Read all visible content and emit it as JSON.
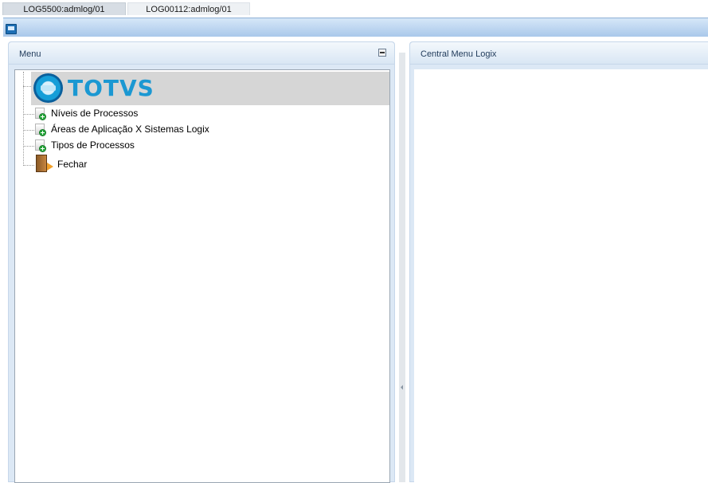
{
  "session_tabs": [
    {
      "label": "LOG5500:admlog/01"
    },
    {
      "label": "LOG00112:admlog/01"
    }
  ],
  "menu_panel": {
    "title": "Menu",
    "logo_text": "TOTVS",
    "items": [
      {
        "label": "Níveis de Processos",
        "icon": "document-add-icon"
      },
      {
        "label": "Áreas de Aplicação X Sistemas Logix",
        "icon": "document-add-icon"
      },
      {
        "label": "Tipos de Processos",
        "icon": "document-add-icon"
      },
      {
        "label": "Fechar",
        "icon": "exit-door-icon"
      }
    ]
  },
  "central_panel": {
    "title": "Central Menu Logix"
  },
  "colors": {
    "window_bar": "#a9c8ea",
    "panel_bg": "#dce8f5",
    "logo_blue": "#1b98d2"
  }
}
